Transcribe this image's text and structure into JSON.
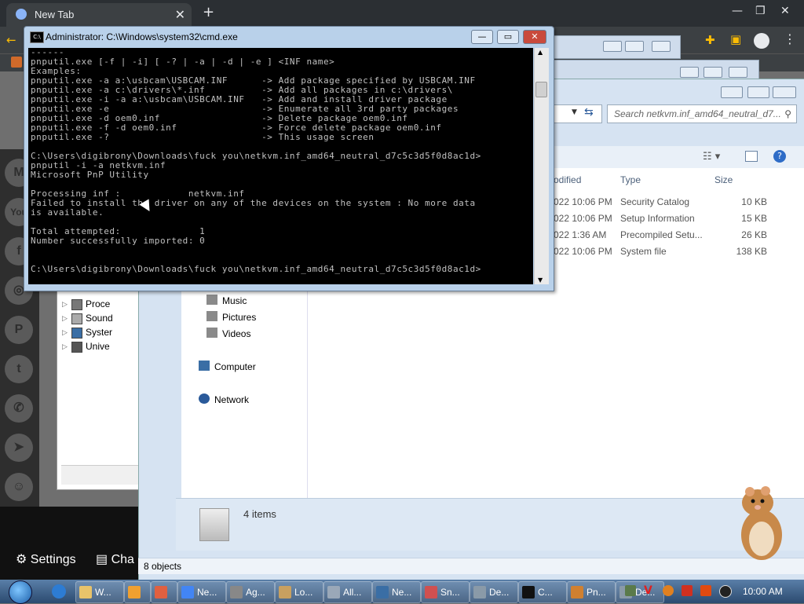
{
  "chrome": {
    "tab_title": "New Tab",
    "tab_close": "✕",
    "new_tab": "+",
    "window_controls": [
      "—",
      "❐",
      "✕"
    ],
    "bottom_settings": "Settings",
    "bottom_chat": "Cha"
  },
  "cmd": {
    "title": "Administrator: C:\\Windows\\system32\\cmd.exe",
    "icon_text": "C:\\",
    "buttons": [
      "—",
      "▭",
      "✕"
    ],
    "lines": [
      "------",
      "pnputil.exe [-f | -i] [ -? | -a | -d | -e ] <INF name>",
      "Examples:",
      "pnputil.exe -a a:\\usbcam\\USBCAM.INF      -> Add package specified by USBCAM.INF",
      "pnputil.exe -a c:\\drivers\\*.inf          -> Add all packages in c:\\drivers\\",
      "pnputil.exe -i -a a:\\usbcam\\USBCAM.INF   -> Add and install driver package",
      "pnputil.exe -e                           -> Enumerate all 3rd party packages",
      "pnputil.exe -d oem0.inf                  -> Delete package oem0.inf",
      "pnputil.exe -f -d oem0.inf               -> Force delete package oem0.inf",
      "pnputil.exe -?                           -> This usage screen",
      "",
      "C:\\Users\\digibrony\\Downloads\\fuck you\\netkvm.inf_amd64_neutral_d7c5c3d5f0d8ac1d>",
      "pnputil -i -a netkvm.inf",
      "Microsoft PnP Utility",
      "",
      "Processing inf :            netkvm.inf",
      "Failed to install the driver on any of the devices on the system : No more data",
      "is available.",
      "",
      "Total attempted:              1",
      "Number successfully imported: 0",
      "",
      "",
      "C:\\Users\\digibrony\\Downloads\\fuck you\\netkvm.inf_amd64_neutral_d7c5c3d5f0d8ac1d>"
    ]
  },
  "explorer": {
    "search_placeholder": "Search netkvm.inf_amd64_neutral_d7...",
    "columns": {
      "modified": "odified",
      "type": "Type",
      "size": "Size"
    },
    "files": [
      {
        "modified": "022 10:06 PM",
        "type": "Security Catalog",
        "size": "10 KB"
      },
      {
        "modified": "022 10:06 PM",
        "type": "Setup Information",
        "size": "15 KB"
      },
      {
        "modified": "022 1:36 AM",
        "type": "Precompiled Setu...",
        "size": "26 KB"
      },
      {
        "modified": "022 10:06 PM",
        "type": "System file",
        "size": "138 KB"
      }
    ],
    "nav": {
      "music": "Music",
      "pictures": "Pictures",
      "videos": "Videos",
      "computer": "Computer",
      "network": "Network"
    },
    "details_count": "4 items",
    "status": "8 objects"
  },
  "device_manager": {
    "items": [
      "Proce",
      "Sound",
      "Syster",
      "Unive"
    ]
  },
  "social": [
    "M",
    "You",
    "f",
    "◎",
    "P",
    "t",
    "✆",
    "➤",
    "☺"
  ],
  "taskbar": {
    "buttons": [
      {
        "label": "W...",
        "color": "#e8c36a"
      },
      {
        "label": "",
        "color": "#f0a030"
      },
      {
        "label": "",
        "color": "#e06040"
      },
      {
        "label": "Ne...",
        "color": "#4285f4"
      },
      {
        "label": "Ag...",
        "color": "#888888"
      },
      {
        "label": "Lo...",
        "color": "#c8a060"
      },
      {
        "label": "All...",
        "color": "#9aa8b8"
      },
      {
        "label": "Ne...",
        "color": "#3a6ea5"
      },
      {
        "label": "Sn...",
        "color": "#d05050"
      },
      {
        "label": "De...",
        "color": "#8a9aa8"
      },
      {
        "label": "C...",
        "color": "#111111"
      },
      {
        "label": "Pn...",
        "color": "#d08030"
      },
      {
        "label": "De...",
        "color": "#8a9aa8"
      }
    ],
    "clock": "10:00 AM"
  },
  "colors": {
    "cmd_bg": "#000000",
    "cmd_fg": "#c0c0c0",
    "taskbar": "#2b4a6f",
    "chrome_dark": "#3c4043"
  }
}
